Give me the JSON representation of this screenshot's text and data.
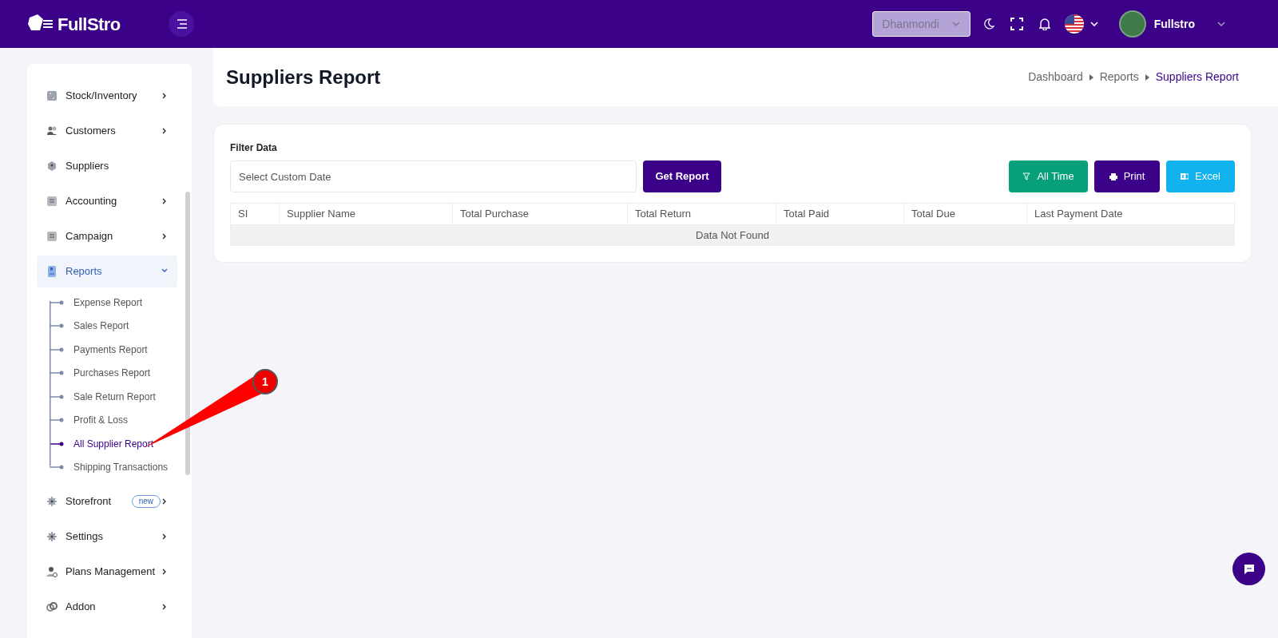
{
  "header": {
    "logo": "FullStro",
    "branch": "Dhanmondi",
    "user": "Fullstro"
  },
  "sidebar": {
    "items": [
      {
        "label": "Stock/Inventory",
        "expanded": false,
        "has_children": true,
        "selected": false
      },
      {
        "label": "Customers",
        "expanded": false,
        "has_children": true,
        "selected": false
      },
      {
        "label": "Suppliers",
        "has_children": false,
        "selected": false
      },
      {
        "label": "Accounting",
        "expanded": false,
        "has_children": true,
        "selected": false
      },
      {
        "label": "Campaign",
        "expanded": false,
        "has_children": true,
        "selected": false
      },
      {
        "label": "Reports",
        "expanded": true,
        "has_children": true,
        "selected": true,
        "children": [
          {
            "label": "Expense Report",
            "selected": false
          },
          {
            "label": "Sales Report",
            "selected": false
          },
          {
            "label": "Payments Report",
            "selected": false
          },
          {
            "label": "Purchases Report",
            "selected": false
          },
          {
            "label": "Sale Return Report",
            "selected": false
          },
          {
            "label": "Profit & Loss",
            "selected": false
          },
          {
            "label": "All Supplier Report",
            "selected": true
          },
          {
            "label": "Shipping Transactions",
            "selected": false
          }
        ]
      },
      {
        "label": "Storefront",
        "badge": "new",
        "expanded": false,
        "has_children": true,
        "selected": false
      },
      {
        "label": "Settings",
        "expanded": false,
        "has_children": true,
        "selected": false
      },
      {
        "label": "Plans Management",
        "expanded": false,
        "has_children": true,
        "selected": false
      },
      {
        "label": "Addon",
        "expanded": false,
        "has_children": true,
        "selected": false
      }
    ]
  },
  "page": {
    "title": "Suppliers Report",
    "breadcrumb": [
      {
        "label": "Dashboard",
        "selected": false
      },
      {
        "label": "Reports",
        "selected": false
      },
      {
        "label": "Suppliers Report",
        "selected": true
      }
    ]
  },
  "filter": {
    "label": "Filter Data",
    "date": {
      "placeholder": "Select Custom Date"
    },
    "submit": "Get Report",
    "actions": [
      {
        "label": "All Time",
        "kind": "filter"
      },
      {
        "label": "Print",
        "kind": "print"
      },
      {
        "label": "Excel",
        "kind": "excel"
      }
    ]
  },
  "table": {
    "columns": [
      "SI",
      "Supplier Name",
      "Total Purchase",
      "Total Return",
      "Total Paid",
      "Total Due",
      "Last Payment Date"
    ],
    "empty_message": "Data Not Found"
  },
  "annotation": {
    "label": "1"
  }
}
